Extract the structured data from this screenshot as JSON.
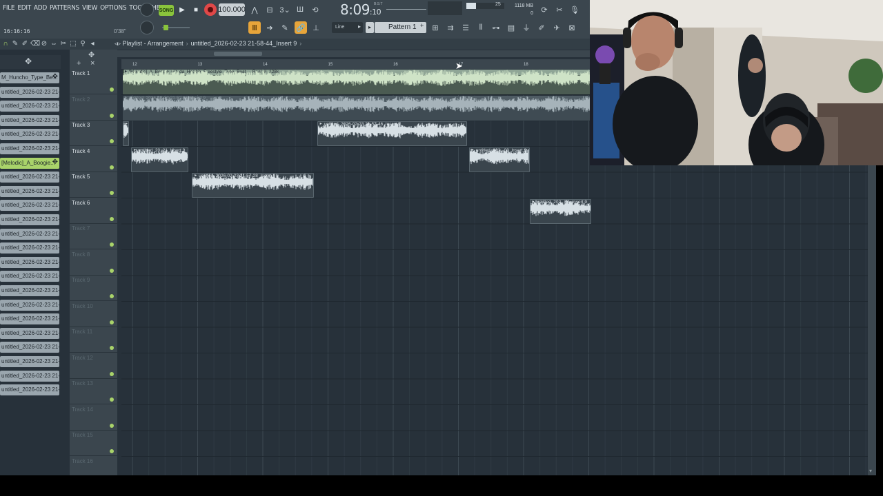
{
  "app": {
    "name": "FL Studio"
  },
  "menu": [
    "FILE",
    "EDIT",
    "ADD",
    "PATTERNS",
    "VIEW",
    "OPTIONS",
    "TOOLS",
    "HELP"
  ],
  "transport": {
    "song_label": "SONG",
    "tempo": "100.000",
    "clock": "8:09",
    "clock_sub": ":10",
    "clock_bst": "B:S:T",
    "timestamp": "16:16:16",
    "song_position": "0'38\"",
    "cpu": "25",
    "memory": "1118 MB",
    "memory_sub": "0"
  },
  "toolbar": {
    "snap": "Line",
    "pattern": "Pattern 1",
    "pattern_plus": "+"
  },
  "playlist": {
    "breadcrumb_root": "Playlist - Arrangement",
    "breadcrumb_current": "untitled_2026-02-23 21-58-44_Insert 9",
    "bars": [
      "12",
      "13",
      "14",
      "15",
      "16",
      "17",
      "18"
    ],
    "tracks": [
      {
        "name": "Track 1",
        "active": true
      },
      {
        "name": "Track 2",
        "active": false
      },
      {
        "name": "Track 3",
        "active": true
      },
      {
        "name": "Track 4",
        "active": true
      },
      {
        "name": "Track 5",
        "active": true
      },
      {
        "name": "Track 6",
        "active": true
      },
      {
        "name": "Track 7",
        "active": false
      },
      {
        "name": "Track 8",
        "active": false
      },
      {
        "name": "Track 9",
        "active": false
      },
      {
        "name": "Track 10",
        "active": false
      },
      {
        "name": "Track 11",
        "active": false
      },
      {
        "name": "Track 12",
        "active": false
      },
      {
        "name": "Track 13",
        "active": false
      },
      {
        "name": "Track 14",
        "active": false
      },
      {
        "name": "Track 15",
        "active": false
      },
      {
        "name": "Track 16",
        "active": false
      }
    ],
    "clips": [
      {
        "track": 0,
        "start": 0.0,
        "length": 7.2,
        "style": "green",
        "label": "[Melodic]_A_Boogie_wit_da_Hoodie_Freestyle_Type_Beat_-_Real_II_128k"
      },
      {
        "track": 1,
        "start": 0.0,
        "length": 7.2,
        "style": "grey",
        "label": "untitled_2026-02-23 21-52-15_Insert 9"
      },
      {
        "track": 2,
        "start": 0.0,
        "length": 0.1,
        "style": "dark",
        "label": ""
      },
      {
        "track": 2,
        "start": 2.98,
        "length": 2.3,
        "style": "dark",
        "label": "untitled_2026-02-23 21-57-46_Insert 9"
      },
      {
        "track": 3,
        "start": 0.13,
        "length": 0.88,
        "style": "dark",
        "label": "untitled_20..21_Insert 9"
      },
      {
        "track": 3,
        "start": 5.31,
        "length": 0.93,
        "style": "dark",
        "label": "untitled_202...00_Insert 9"
      },
      {
        "track": 4,
        "start": 1.06,
        "length": 1.87,
        "style": "dark",
        "label": "untitled_2026-02-23 21-57-28_Insert 9"
      },
      {
        "track": 5,
        "start": 6.24,
        "length": 0.95,
        "style": "dark",
        "label": "untitled_202...44_Insert 9"
      }
    ]
  },
  "picker": [
    {
      "label": "M_Huncho_Type_Be...",
      "selected": false
    },
    {
      "label": "untitled_2026-02-23 21-...",
      "selected": false
    },
    {
      "label": "untitled_2026-02-23 21-...",
      "selected": false
    },
    {
      "label": "untitled_2026-02-23 21-...",
      "selected": false
    },
    {
      "label": "untitled_2026-02-23 21-...",
      "selected": false
    },
    {
      "label": "untitled_2026-02-23 21-...",
      "selected": false
    },
    {
      "label": "[Melodic]_A_Boogie...",
      "selected": true
    },
    {
      "label": "untitled_2026-02-23 21-...",
      "selected": false
    },
    {
      "label": "untitled_2026-02-23 21-...",
      "selected": false
    },
    {
      "label": "untitled_2026-02-23 21-...",
      "selected": false
    },
    {
      "label": "untitled_2026-02-23 21-...",
      "selected": false
    },
    {
      "label": "untitled_2026-02-23 21-...",
      "selected": false
    },
    {
      "label": "untitled_2026-02-23 21-...",
      "selected": false
    },
    {
      "label": "untitled_2026-02-23 21-...",
      "selected": false
    },
    {
      "label": "untitled_2026-02-23 21-...",
      "selected": false
    },
    {
      "label": "untitled_2026-02-23 21-...",
      "selected": false
    },
    {
      "label": "untitled_2026-02-23 21-...",
      "selected": false
    },
    {
      "label": "untitled_2026-02-23 21-...",
      "selected": false
    },
    {
      "label": "untitled_2026-02-23 21-...",
      "selected": false
    },
    {
      "label": "untitled_2026-02-23 21-...",
      "selected": false
    },
    {
      "label": "untitled_2026-02-23 21-...",
      "selected": false
    },
    {
      "label": "untitled_2026-02-23 21-...",
      "selected": false
    },
    {
      "label": "untitled_2026-02-23 21-...",
      "selected": false
    }
  ],
  "webcam": {
    "description_icon": "webcam-feed-icon"
  }
}
